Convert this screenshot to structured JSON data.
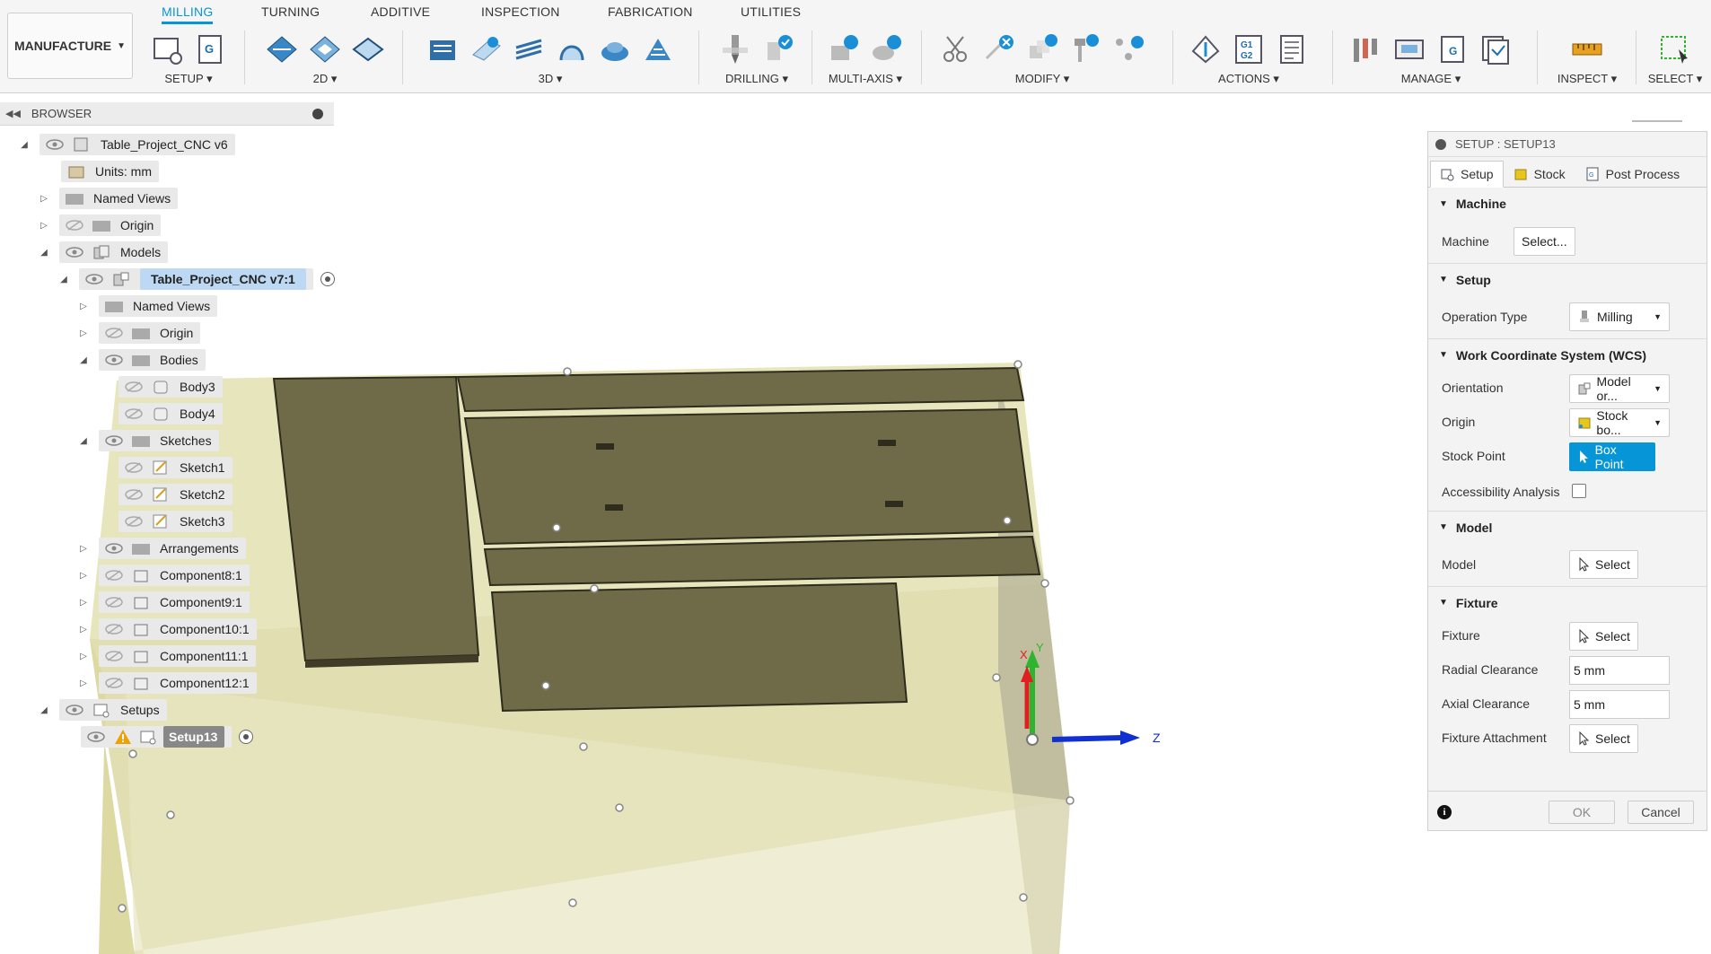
{
  "toolbar": {
    "workspace": "MANUFACTURE",
    "tabs": [
      "MILLING",
      "TURNING",
      "ADDITIVE",
      "INSPECTION",
      "FABRICATION",
      "UTILITIES"
    ],
    "active_tab": "MILLING",
    "groups": [
      "SETUP ▾",
      "2D ▾",
      "3D ▾",
      "DRILLING ▾",
      "MULTI-AXIS ▾",
      "MODIFY ▾",
      "ACTIONS ▾",
      "MANAGE ▾",
      "INSPECT ▾",
      "SELECT ▾"
    ]
  },
  "browser": {
    "title": "BROWSER",
    "items": [
      {
        "label": "Table_Project_CNC v6"
      },
      {
        "label": "Units: mm"
      },
      {
        "label": "Named Views"
      },
      {
        "label": "Origin"
      },
      {
        "label": "Models"
      },
      {
        "label": "Table_Project_CNC v7:1"
      },
      {
        "label": "Named Views"
      },
      {
        "label": "Origin"
      },
      {
        "label": "Bodies"
      },
      {
        "label": "Body3"
      },
      {
        "label": "Body4"
      },
      {
        "label": "Sketches"
      },
      {
        "label": "Sketch1"
      },
      {
        "label": "Sketch2"
      },
      {
        "label": "Sketch3"
      },
      {
        "label": "Arrangements"
      },
      {
        "label": "Component8:1"
      },
      {
        "label": "Component9:1"
      },
      {
        "label": "Component10:1"
      },
      {
        "label": "Component11:1"
      },
      {
        "label": "Component12:1"
      },
      {
        "label": "Setups"
      },
      {
        "label": "Setup13"
      }
    ]
  },
  "viewport": {
    "axis_x": "X",
    "axis_y": "Y",
    "axis_z": "Z"
  },
  "panel": {
    "title": "SETUP : SETUP13",
    "tabs": [
      "Setup",
      "Stock",
      "Post Process"
    ],
    "sections": {
      "machine": {
        "title": "Machine",
        "machine_label": "Machine",
        "machine_btn": "Select..."
      },
      "setup": {
        "title": "Setup",
        "op_label": "Operation Type",
        "op_value": "Milling"
      },
      "wcs": {
        "title": "Work Coordinate System (WCS)",
        "orient_label": "Orientation",
        "orient_value": "Model or...",
        "origin_label": "Origin",
        "origin_value": "Stock bo...",
        "stock_point_label": "Stock Point",
        "stock_point_value": "Box Point",
        "access_label": "Accessibility Analysis"
      },
      "model": {
        "title": "Model",
        "model_label": "Model",
        "model_btn": "Select"
      },
      "fixture": {
        "title": "Fixture",
        "fixture_label": "Fixture",
        "fixture_btn": "Select",
        "radial_label": "Radial Clearance",
        "radial_value": "5 mm",
        "axial_label": "Axial Clearance",
        "axial_value": "5 mm",
        "attach_label": "Fixture Attachment",
        "attach_btn": "Select"
      }
    },
    "ok": "OK",
    "cancel": "Cancel"
  },
  "colors": {
    "accent": "#0696d7",
    "stock": "#e7e5b8",
    "part": "#6f6a48"
  }
}
